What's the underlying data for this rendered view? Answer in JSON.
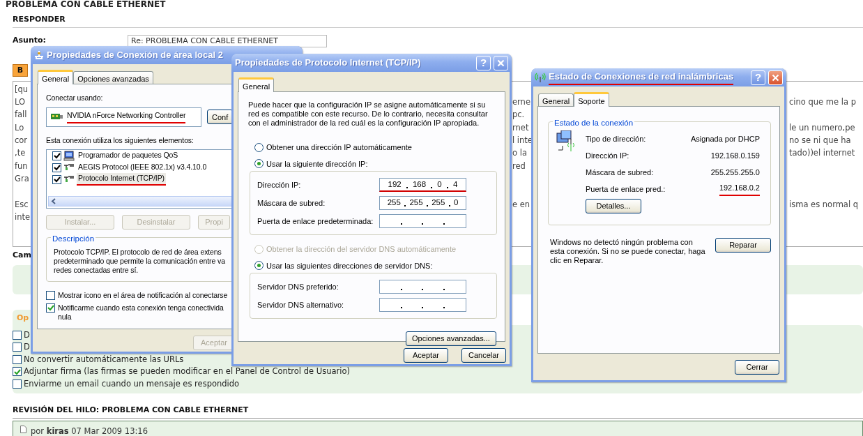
{
  "page": {
    "title": "PROBLEMA CON CABLE ETHERNET",
    "reply_heading": "RESPONDER",
    "subject_label": "Asunto:",
    "subject_value": "Re: PROBLEMA CON CABLE ETHERNET",
    "bold_button": "B",
    "message_lines": [
      {
        "left": "[qu"
      },
      {
        "left": "LO",
        "middle": "erne",
        "right": "cino que me la p"
      },
      {
        "left": "fall",
        "middle": "pc."
      },
      {
        "left": "Lo",
        "middle": "rnet",
        "right": "le un numero,pe"
      },
      {
        "left": "cor",
        "middle": "l inte",
        "right": "no se ni que ha"
      },
      {
        "left": ",te",
        "middle": "o la",
        "right": "tado))el internet"
      },
      {
        "left": "fun",
        "middle": "red"
      },
      {
        "left": "Gra"
      },
      {
        "left": "Esc",
        "middle": "e en",
        "right": "isma es normal q"
      },
      {
        "left": "inte"
      }
    ],
    "cut_label": "Cam",
    "options_tab": "Op",
    "options": [
      {
        "label": "D",
        "checked": false
      },
      {
        "label": "D",
        "checked": false
      },
      {
        "label": "No convertir automáticamente las URLs",
        "checked": false
      },
      {
        "label": "Adjuntar firma (las firmas se pueden modificar en el Panel de Control de Usuario)",
        "checked": true
      },
      {
        "label": "Enviarme un email cuando un mensaje es respondido",
        "checked": false
      }
    ],
    "review_heading": "REVISIÓN DEL HILO: PROBLEMA CON CABLE ETHERNET",
    "byline": "por **kiras** 07 Mar 2009 13:16"
  },
  "connection_properties": {
    "title": "Propiedades de Conexión de área local 2",
    "tabs": [
      {
        "label": "General",
        "selected": true
      },
      {
        "label": "Opciones avanzadas",
        "selected": false
      }
    ],
    "connect_using_label": "Conectar usando:",
    "adapter": {
      "name": "NVIDIA nForce Networking Controller",
      "underlined": true
    },
    "configure_button": "Conf",
    "components_label": "Esta conexión utiliza los siguientes elementos:",
    "components": [
      {
        "name": "Programador de paquetes QoS",
        "checked": true,
        "kind": "scheduler",
        "selected": false,
        "underlined": false
      },
      {
        "name": "AEGIS Protocol (IEEE 802.1x) v3.4.10.0",
        "checked": true,
        "kind": "protocol",
        "selected": false,
        "underlined": false
      },
      {
        "name": "Protocolo Internet (TCP/IP)",
        "checked": true,
        "kind": "protocol",
        "selected": true,
        "underlined": true
      }
    ],
    "buttons": [
      {
        "label": "Instalar...",
        "disabled": true
      },
      {
        "label": "Desinstalar",
        "disabled": true
      },
      {
        "label": "Propi",
        "disabled": true
      }
    ],
    "description": {
      "legend": "Descripción",
      "lines": [
        "Protocolo TCP/IP. El protocolo de red de área extens",
        "predeterminado que permite la comunicación entre va",
        "redes conectadas entre sí."
      ]
    },
    "checkboxes": [
      {
        "lines": [
          "Mostrar icono en el área de notificación al conectarse"
        ],
        "checked": false
      },
      {
        "lines": [
          "Notificarme cuando esta conexión tenga conectivida",
          "nula"
        ],
        "checked": true
      }
    ],
    "ok_button": {
      "label": "Aceptar",
      "disabled": true
    }
  },
  "tcpip_properties": {
    "title": "Propiedades de Protocolo Internet (TCP/IP)",
    "help_button": "?",
    "tabs": [
      {
        "label": "General",
        "selected": true
      }
    ],
    "intro": "Puede hacer que la configuración IP se asigne automáticamente si su red es compatible con este recurso. De lo contrario, necesita consultar con el administrador de la red cuál es la configuración IP apropiada.",
    "ip_mode": [
      {
        "label": "Obtener una dirección IP automáticamente",
        "selected": false
      },
      {
        "label": "Usar la siguiente dirección IP:",
        "selected": true
      }
    ],
    "ip_fields": [
      {
        "label": "Dirección IP:",
        "octets": [
          "192",
          "168",
          "0",
          "4"
        ],
        "underlined": true
      },
      {
        "label": "Máscara de subred:",
        "octets": [
          "255",
          "255",
          "255",
          "0"
        ],
        "underlined": false
      },
      {
        "label": "Puerta de enlace predeterminada:",
        "underlined": false
      }
    ],
    "dns_mode": [
      {
        "label": "Obtener la dirección del servidor DNS automáticamente",
        "selected": false,
        "disabled": true
      },
      {
        "label": "Usar las siguientes direcciones de servidor DNS:",
        "selected": true,
        "disabled": false
      }
    ],
    "dns_fields": [
      {
        "label": "Servidor DNS preferido:",
        "underlined": false
      },
      {
        "label": "Servidor DNS alternativo:",
        "underlined": false
      }
    ],
    "advanced_button": "Opciones avanzadas...",
    "buttons": [
      "Aceptar",
      "Cancelar"
    ]
  },
  "wireless_status": {
    "title": "Estado de Conexiones de red inalámbricas",
    "title_underlined": true,
    "help_button": "?",
    "tabs": [
      {
        "label": "General",
        "selected": false
      },
      {
        "label": "Soporte",
        "selected": true
      }
    ],
    "group_legend": "Estado de la conexión",
    "rows": [
      {
        "label": "Tipo de dirección:",
        "value": "Asignada por DHCP",
        "underlined": false
      },
      {
        "label": "Dirección IP:",
        "value": "192.168.0.159",
        "underlined": false
      },
      {
        "label": "Máscara de subred:",
        "value": "255.255.255.0",
        "underlined": false
      },
      {
        "label": "Puerta de enlace pred.:",
        "value": "192.168.0.2",
        "underlined": true
      }
    ],
    "details_button": "Detalles...",
    "message": "Windows no detectó ningún problema con esta conexión. Si no se puede conectar, haga clic en Reparar.",
    "repair_button": "Reparar",
    "close_button": "Cerrar"
  }
}
